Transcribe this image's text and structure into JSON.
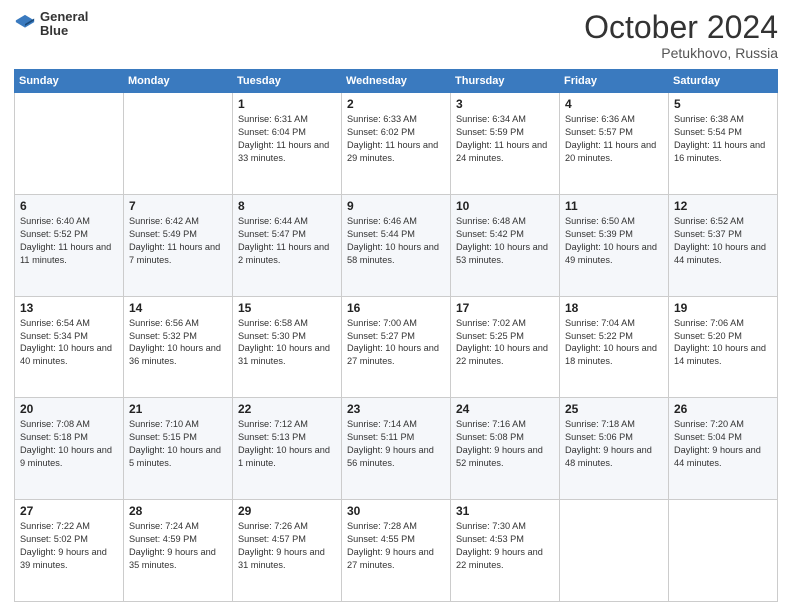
{
  "header": {
    "logo_line1": "General",
    "logo_line2": "Blue",
    "title": "October 2024",
    "location": "Petukhovo, Russia"
  },
  "columns": [
    "Sunday",
    "Monday",
    "Tuesday",
    "Wednesday",
    "Thursday",
    "Friday",
    "Saturday"
  ],
  "weeks": [
    [
      {
        "day": "",
        "info": ""
      },
      {
        "day": "",
        "info": ""
      },
      {
        "day": "1",
        "info": "Sunrise: 6:31 AM\nSunset: 6:04 PM\nDaylight: 11 hours and 33 minutes."
      },
      {
        "day": "2",
        "info": "Sunrise: 6:33 AM\nSunset: 6:02 PM\nDaylight: 11 hours and 29 minutes."
      },
      {
        "day": "3",
        "info": "Sunrise: 6:34 AM\nSunset: 5:59 PM\nDaylight: 11 hours and 24 minutes."
      },
      {
        "day": "4",
        "info": "Sunrise: 6:36 AM\nSunset: 5:57 PM\nDaylight: 11 hours and 20 minutes."
      },
      {
        "day": "5",
        "info": "Sunrise: 6:38 AM\nSunset: 5:54 PM\nDaylight: 11 hours and 16 minutes."
      }
    ],
    [
      {
        "day": "6",
        "info": "Sunrise: 6:40 AM\nSunset: 5:52 PM\nDaylight: 11 hours and 11 minutes."
      },
      {
        "day": "7",
        "info": "Sunrise: 6:42 AM\nSunset: 5:49 PM\nDaylight: 11 hours and 7 minutes."
      },
      {
        "day": "8",
        "info": "Sunrise: 6:44 AM\nSunset: 5:47 PM\nDaylight: 11 hours and 2 minutes."
      },
      {
        "day": "9",
        "info": "Sunrise: 6:46 AM\nSunset: 5:44 PM\nDaylight: 10 hours and 58 minutes."
      },
      {
        "day": "10",
        "info": "Sunrise: 6:48 AM\nSunset: 5:42 PM\nDaylight: 10 hours and 53 minutes."
      },
      {
        "day": "11",
        "info": "Sunrise: 6:50 AM\nSunset: 5:39 PM\nDaylight: 10 hours and 49 minutes."
      },
      {
        "day": "12",
        "info": "Sunrise: 6:52 AM\nSunset: 5:37 PM\nDaylight: 10 hours and 44 minutes."
      }
    ],
    [
      {
        "day": "13",
        "info": "Sunrise: 6:54 AM\nSunset: 5:34 PM\nDaylight: 10 hours and 40 minutes."
      },
      {
        "day": "14",
        "info": "Sunrise: 6:56 AM\nSunset: 5:32 PM\nDaylight: 10 hours and 36 minutes."
      },
      {
        "day": "15",
        "info": "Sunrise: 6:58 AM\nSunset: 5:30 PM\nDaylight: 10 hours and 31 minutes."
      },
      {
        "day": "16",
        "info": "Sunrise: 7:00 AM\nSunset: 5:27 PM\nDaylight: 10 hours and 27 minutes."
      },
      {
        "day": "17",
        "info": "Sunrise: 7:02 AM\nSunset: 5:25 PM\nDaylight: 10 hours and 22 minutes."
      },
      {
        "day": "18",
        "info": "Sunrise: 7:04 AM\nSunset: 5:22 PM\nDaylight: 10 hours and 18 minutes."
      },
      {
        "day": "19",
        "info": "Sunrise: 7:06 AM\nSunset: 5:20 PM\nDaylight: 10 hours and 14 minutes."
      }
    ],
    [
      {
        "day": "20",
        "info": "Sunrise: 7:08 AM\nSunset: 5:18 PM\nDaylight: 10 hours and 9 minutes."
      },
      {
        "day": "21",
        "info": "Sunrise: 7:10 AM\nSunset: 5:15 PM\nDaylight: 10 hours and 5 minutes."
      },
      {
        "day": "22",
        "info": "Sunrise: 7:12 AM\nSunset: 5:13 PM\nDaylight: 10 hours and 1 minute."
      },
      {
        "day": "23",
        "info": "Sunrise: 7:14 AM\nSunset: 5:11 PM\nDaylight: 9 hours and 56 minutes."
      },
      {
        "day": "24",
        "info": "Sunrise: 7:16 AM\nSunset: 5:08 PM\nDaylight: 9 hours and 52 minutes."
      },
      {
        "day": "25",
        "info": "Sunrise: 7:18 AM\nSunset: 5:06 PM\nDaylight: 9 hours and 48 minutes."
      },
      {
        "day": "26",
        "info": "Sunrise: 7:20 AM\nSunset: 5:04 PM\nDaylight: 9 hours and 44 minutes."
      }
    ],
    [
      {
        "day": "27",
        "info": "Sunrise: 7:22 AM\nSunset: 5:02 PM\nDaylight: 9 hours and 39 minutes."
      },
      {
        "day": "28",
        "info": "Sunrise: 7:24 AM\nSunset: 4:59 PM\nDaylight: 9 hours and 35 minutes."
      },
      {
        "day": "29",
        "info": "Sunrise: 7:26 AM\nSunset: 4:57 PM\nDaylight: 9 hours and 31 minutes."
      },
      {
        "day": "30",
        "info": "Sunrise: 7:28 AM\nSunset: 4:55 PM\nDaylight: 9 hours and 27 minutes."
      },
      {
        "day": "31",
        "info": "Sunrise: 7:30 AM\nSunset: 4:53 PM\nDaylight: 9 hours and 22 minutes."
      },
      {
        "day": "",
        "info": ""
      },
      {
        "day": "",
        "info": ""
      }
    ]
  ]
}
